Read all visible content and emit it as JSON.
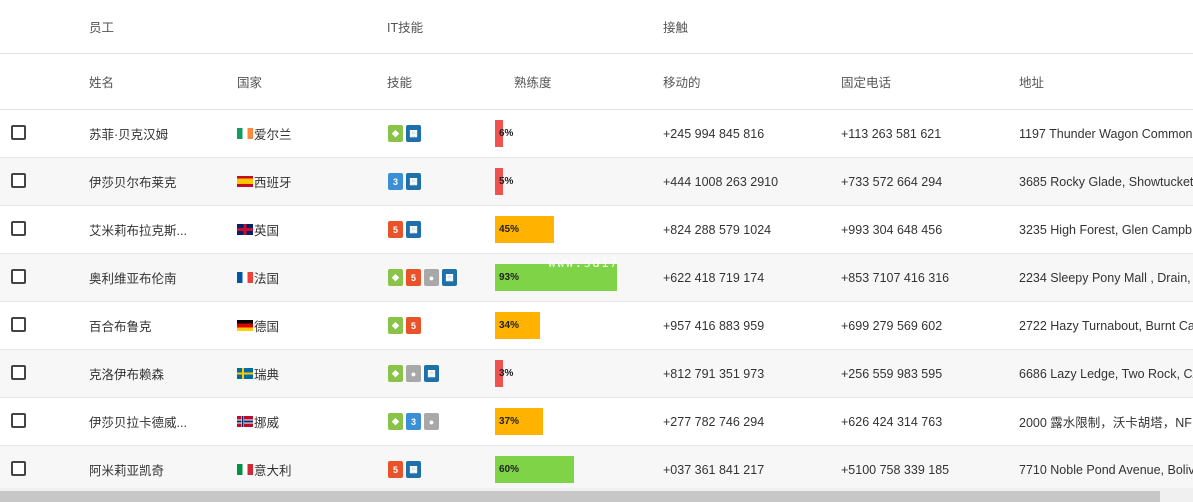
{
  "group_headers": {
    "employee": "员工",
    "it_skills": "IT技能",
    "contact": "接触"
  },
  "column_headers": {
    "name": "姓名",
    "country": "国家",
    "skills": "技能",
    "proficiency": "熟练度",
    "mobile": "移动的",
    "landline": "固定电话",
    "address": "地址"
  },
  "rows": [
    {
      "name": "苏菲·贝克汉姆",
      "country": "爱尔兰",
      "flag": "ie",
      "skills": [
        "android",
        "windows"
      ],
      "proficiency": 6,
      "prof_label": "6%",
      "mobile": "+245 994 845 816",
      "landline": "+113 263 581 621",
      "address": "1197 Thunder Wagon Common"
    },
    {
      "name": "伊莎贝尔布莱克",
      "country": "西班牙",
      "flag": "es",
      "skills": [
        "css3",
        "windows"
      ],
      "proficiency": 5,
      "prof_label": "5%",
      "mobile": "+444 1008 263 2910",
      "landline": "+733 572 664 294",
      "address": "3685 Rocky Glade, Showtucket"
    },
    {
      "name": "艾米莉布拉克斯...",
      "country": "英国",
      "flag": "gb",
      "skills": [
        "html5",
        "windows"
      ],
      "proficiency": 45,
      "prof_label": "45%",
      "mobile": "+824 288 579 1024",
      "landline": "+993 304 648 456",
      "address": "3235 High Forest, Glen Campb"
    },
    {
      "name": "奥利维亚布伦南",
      "country": "法国",
      "flag": "fr",
      "skills": [
        "android",
        "html5",
        "apple",
        "windows"
      ],
      "proficiency": 93,
      "prof_label": "93%",
      "mobile": "+622 418 719 174",
      "landline": "+853 7107 416 316",
      "address": "2234 Sleepy Pony Mall , Drain,"
    },
    {
      "name": "百合布鲁克",
      "country": "德国",
      "flag": "de",
      "skills": [
        "android",
        "html5"
      ],
      "proficiency": 34,
      "prof_label": "34%",
      "mobile": "+957 416 883 959",
      "landline": "+699 279 569 602",
      "address": "2722 Hazy Turnabout, Burnt Ca"
    },
    {
      "name": "克洛伊布赖森",
      "country": "瑞典",
      "flag": "se",
      "skills": [
        "android",
        "apple",
        "windows"
      ],
      "proficiency": 3,
      "prof_label": "3%",
      "mobile": "+812 791 351 973",
      "landline": "+256 559 983 595",
      "address": "6686 Lazy Ledge, Two Rock, CA"
    },
    {
      "name": "伊莎贝拉卡德威...",
      "country": "挪威",
      "flag": "no",
      "skills": [
        "android",
        "css3",
        "apple"
      ],
      "proficiency": 37,
      "prof_label": "37%",
      "mobile": "+277 782 746 294",
      "landline": "+626 424 314 763",
      "address": "2000 露水限制，沃卡胡塔，NF"
    },
    {
      "name": "阿米莉亚凯奇",
      "country": "意大利",
      "flag": "it",
      "skills": [
        "html5",
        "windows"
      ],
      "proficiency": 60,
      "prof_label": "60%",
      "mobile": "+037 361 841 217",
      "landline": "+5100 758 339 185",
      "address": "7710 Noble Pond Avenue, Boliv"
    }
  ],
  "colors": {
    "low": "#ef5350",
    "mid": "#ffb300",
    "high": "#7ed346"
  },
  "watermark": "www.sd17"
}
